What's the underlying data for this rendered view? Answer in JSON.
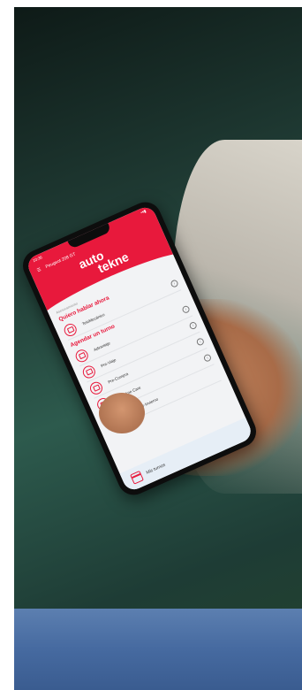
{
  "status_bar": {
    "time": "10:36",
    "extra": "Ds",
    "battery": "•▾▮"
  },
  "top_bar": {
    "menu_icon": "menu-icon",
    "user_label": "Peugeot 208 GT"
  },
  "brand": {
    "line1": "auto",
    "line2": "tekne"
  },
  "sections": [
    {
      "title": "Quiero hablar ahora",
      "overline": "Asesoramiento",
      "items": [
        {
          "label": "TeleMecánico",
          "icon": "mechanic-icon"
        }
      ]
    },
    {
      "title": "Agendar un turno",
      "items": [
        {
          "label": "Advantaje",
          "icon": "wrench-icon"
        },
        {
          "label": "Pre-Viaje",
          "icon": "car-icon"
        },
        {
          "label": "Pre-Compra",
          "icon": "handshake-icon"
        },
        {
          "label": "Autotekne Care",
          "icon": "shield-icon"
        },
        {
          "label": "Chequeo Pre-Invierno",
          "icon": "snow-icon"
        }
      ]
    }
  ],
  "footer": {
    "label": "Mis turnos",
    "icon": "calendar-icon"
  },
  "colors": {
    "brand_red": "#e8193c"
  }
}
